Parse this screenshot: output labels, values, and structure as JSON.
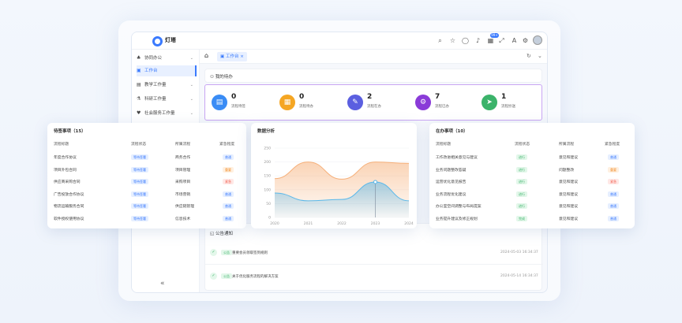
{
  "app": {
    "name": "灯塔"
  },
  "topbar": {
    "icons": [
      "search-icon",
      "star-icon",
      "chat-icon",
      "bell-icon",
      "grid-icon",
      "expand-icon",
      "translate-icon",
      "gear-icon"
    ],
    "badge": "99+"
  },
  "sidebar": {
    "items": [
      {
        "label": "协同办公",
        "icon": "people-icon",
        "active": false
      },
      {
        "label": "工作台",
        "icon": "desk-icon",
        "active": true
      },
      {
        "label": "教学工作量",
        "icon": "book-icon",
        "active": false
      },
      {
        "label": "科研工作量",
        "icon": "flask-icon",
        "active": false
      },
      {
        "label": "社会服务工作量",
        "icon": "heart-icon",
        "active": false
      }
    ],
    "collapse": "«"
  },
  "tabs": [
    {
      "label": "工作台"
    }
  ],
  "stats": {
    "title": "我的待办",
    "items": [
      {
        "value": "0",
        "label": "流程待签",
        "color": "#3a8cf5",
        "icon": "📋"
      },
      {
        "value": "0",
        "label": "流程待办",
        "color": "#f5a623",
        "icon": "📝"
      },
      {
        "value": "2",
        "label": "流程在办",
        "color": "#5b5fe0",
        "icon": "✎"
      },
      {
        "value": "7",
        "label": "流程已办",
        "color": "#8a3bd8",
        "icon": "⚙"
      },
      {
        "value": "1",
        "label": "流程抄送",
        "color": "#3bb36a",
        "icon": "➤"
      }
    ]
  },
  "pending": {
    "title": "待签事项（15）",
    "headers": [
      "流程标题",
      "流程状态",
      "所属流程",
      "紧急程度"
    ],
    "rows": [
      {
        "title": "年度合作协议",
        "status": "等待签署",
        "process": "商务合作",
        "urgency": "普通"
      },
      {
        "title": "项目外包合同",
        "status": "等待签署",
        "process": "项目管理",
        "urgency": "重要"
      },
      {
        "title": "供应商采购合同",
        "status": "等待签署",
        "process": "采购项目",
        "urgency": "紧急"
      },
      {
        "title": "广告投放合作协议",
        "status": "等待签署",
        "process": "市场营销",
        "urgency": "普通"
      },
      {
        "title": "物流运输服务合同",
        "status": "等待签署",
        "process": "供应链管理",
        "urgency": "普通"
      },
      {
        "title": "软件授权使用协议",
        "status": "等待签署",
        "process": "信息技术",
        "urgency": "普通"
      }
    ]
  },
  "chart": {
    "title": "数据分析",
    "chart_data": {
      "type": "area",
      "x": [
        "2020",
        "2021",
        "2022",
        "2023",
        "2024"
      ],
      "ylim": [
        0,
        250
      ],
      "yticks": [
        0,
        50,
        100,
        150,
        200,
        250
      ],
      "series": [
        {
          "color": "#f6b07a",
          "values": [
            140,
            200,
            138,
            200,
            195
          ]
        },
        {
          "color": "#5ab8ea",
          "values": [
            88,
            60,
            65,
            128,
            60
          ]
        }
      ],
      "highlight_x": "2023"
    }
  },
  "inprogress": {
    "title": "在办事项（10）",
    "headers": [
      "流程标题",
      "流程状态",
      "所属流程",
      "紧急程度"
    ],
    "rows": [
      {
        "title": "工作改进相关意见与建议",
        "status": "进行",
        "process": "意见和建议",
        "urgency": "普通"
      },
      {
        "title": "业务问题整改答疑",
        "status": "进行",
        "process": "问题整改",
        "urgency": "重要"
      },
      {
        "title": "运营优化意见报告",
        "status": "进行",
        "process": "意见和建议",
        "urgency": "紧急"
      },
      {
        "title": "业务流程优化建议",
        "status": "进行",
        "process": "意见和建议",
        "urgency": "普通"
      },
      {
        "title": "办公室空间调整与布局提案",
        "status": "进行",
        "process": "意见和建议",
        "urgency": "普通"
      },
      {
        "title": "业务提升建议及修正规划",
        "status": "完成",
        "process": "意见和建议",
        "urgency": "普通"
      }
    ]
  },
  "notices": {
    "title": "公告通知",
    "items": [
      {
        "tag": "公告",
        "text": "重要会员领取签到规则",
        "time": "2024-05-03 16:34:37"
      },
      {
        "tag": "公告",
        "text": "关于优化服务流程的解决方案",
        "time": "2024-05-14 16:34:37"
      }
    ]
  }
}
